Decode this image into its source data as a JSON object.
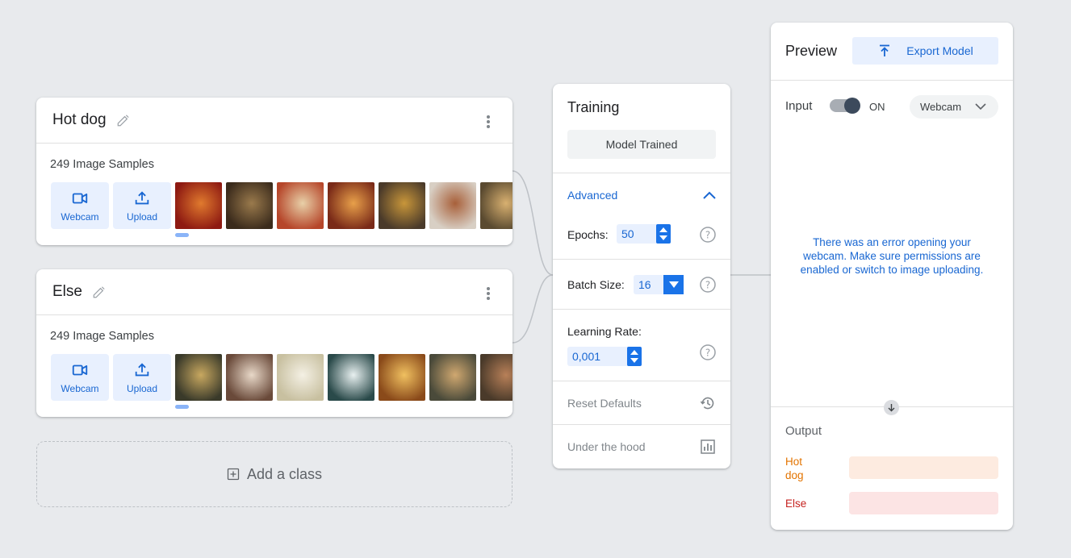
{
  "classes": [
    {
      "name": "Hot dog",
      "samples_label": "249 Image Samples",
      "webcam_label": "Webcam",
      "upload_label": "Upload",
      "thumb_colors": [
        [
          "#8e1a12",
          "#e07a2e"
        ],
        [
          "#3b2b1c",
          "#9a7a4c"
        ],
        [
          "#b6462a",
          "#e8d0a8"
        ],
        [
          "#7a2a18",
          "#e8a04a"
        ],
        [
          "#4a3a2a",
          "#c8963a"
        ],
        [
          "#d8cfc4",
          "#a8603a"
        ],
        [
          "#5a4a30",
          "#d8b070"
        ]
      ]
    },
    {
      "name": "Else",
      "samples_label": "249 Image Samples",
      "webcam_label": "Webcam",
      "upload_label": "Upload",
      "thumb_colors": [
        [
          "#3a3a2a",
          "#c8a860"
        ],
        [
          "#6a4a3a",
          "#e8d8c8"
        ],
        [
          "#c8c0a0",
          "#f4f0e4"
        ],
        [
          "#2a4a4a",
          "#e8f0f0"
        ],
        [
          "#8a4a1a",
          "#f0c060"
        ],
        [
          "#4a4a3a",
          "#d0a870"
        ],
        [
          "#4a3a2a",
          "#b88058"
        ]
      ]
    }
  ],
  "add_class_label": "Add a class",
  "training": {
    "title": "Training",
    "model_button": "Model Trained",
    "advanced_label": "Advanced",
    "epochs_label": "Epochs:",
    "epochs_value": "50",
    "batch_label": "Batch Size:",
    "batch_value": "16",
    "lr_label": "Learning Rate:",
    "lr_value": "0,001",
    "reset_label": "Reset Defaults",
    "hood_label": "Under the hood"
  },
  "preview": {
    "title": "Preview",
    "export_label": "Export Model",
    "input_label": "Input",
    "toggle_state": "ON",
    "source_select": "Webcam",
    "error_message": "There was an error opening your webcam. Make sure permissions are enabled or switch to image uploading.",
    "output_label": "Output",
    "outputs": [
      {
        "name": "Hot\ndog",
        "color": "#e37400",
        "bar": "#fdebe0"
      },
      {
        "name": "Else",
        "color": "#c5221f",
        "bar": "#fce4e4"
      }
    ]
  },
  "colors": {
    "accent": "#1a73e8",
    "accent_text": "#1967d2",
    "light_accent": "#e8f0fe"
  }
}
